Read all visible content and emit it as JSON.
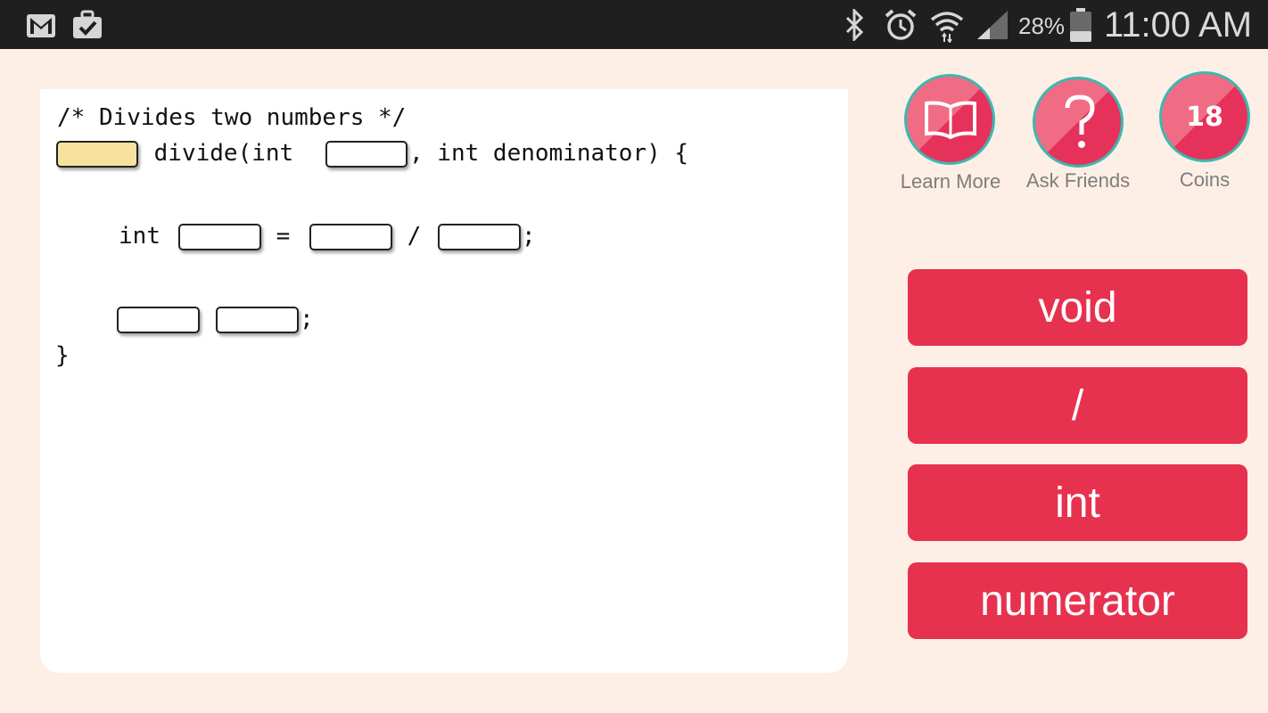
{
  "status_bar": {
    "icons": [
      "gmail-icon",
      "briefcase-check-icon",
      "bluetooth-icon",
      "alarm-icon",
      "wifi-icon",
      "signal-icon",
      "battery-icon"
    ],
    "battery": "28%",
    "time": "11:00 AM"
  },
  "code": {
    "comment": "/* Divides two numbers */",
    "line2_mid": " divide(int ",
    "line2_end": ", int denominator) {",
    "line3_start": "int ",
    "line3_eq": " = ",
    "line3_div": " / ",
    "semicolon": ";",
    "close_brace": "}"
  },
  "toolbar": {
    "learn_more": "Learn More",
    "ask_friends": "Ask Friends",
    "coins_label": "Coins",
    "coins_value": "18"
  },
  "options": [
    "void",
    "/",
    "int",
    "numerator"
  ],
  "colors": {
    "accent": "#e6324f",
    "teal_ring": "#3db7b0",
    "background": "#fdefe5",
    "active_blank": "#f6e29e"
  }
}
